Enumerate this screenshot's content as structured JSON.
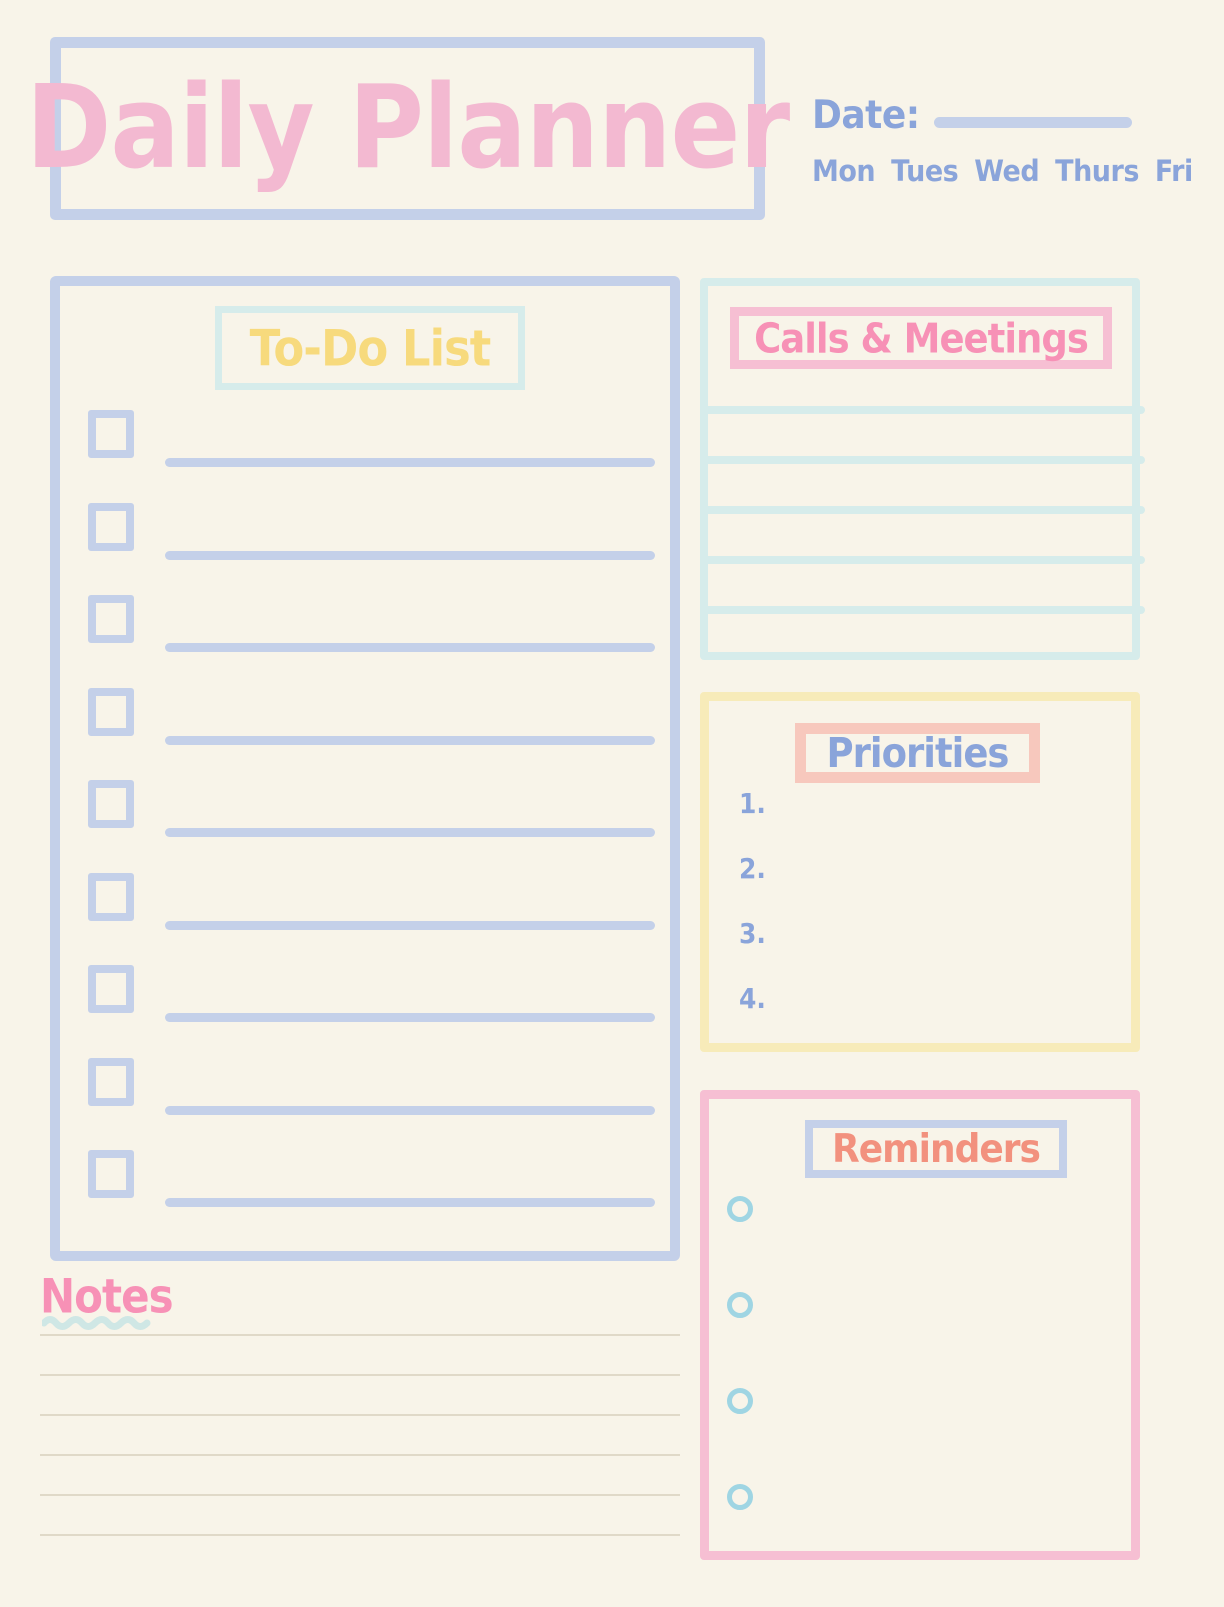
{
  "document": {
    "title": "Daily Planner",
    "background_color": "#f8f4e9"
  },
  "header": {
    "title": "Daily Planner",
    "title_color": "#f3b9d1",
    "title_box_border_color": "#c4d0e9",
    "date_label": "Date:",
    "date_value": "",
    "date_color": "#8aa4da",
    "weekdays": [
      "Mon",
      "Tues",
      "Wed",
      "Thurs",
      "Fri"
    ]
  },
  "todo": {
    "heading": "To-Do List",
    "heading_color": "#f7da7d",
    "heading_box_border_color": "#d6eceb",
    "panel_border_color": "#c4d0e9",
    "items": [
      {
        "checked": false,
        "text": ""
      },
      {
        "checked": false,
        "text": ""
      },
      {
        "checked": false,
        "text": ""
      },
      {
        "checked": false,
        "text": ""
      },
      {
        "checked": false,
        "text": ""
      },
      {
        "checked": false,
        "text": ""
      },
      {
        "checked": false,
        "text": ""
      },
      {
        "checked": false,
        "text": ""
      },
      {
        "checked": false,
        "text": ""
      }
    ]
  },
  "notes": {
    "heading": "Notes",
    "heading_color": "#f791b6",
    "underline_color": "#cfe7e5",
    "line_color": "#e0d9c8",
    "lines": [
      "",
      "",
      "",
      "",
      "",
      ""
    ]
  },
  "calls": {
    "heading": "Calls & Meetings",
    "heading_color": "#f791b6",
    "heading_box_border_color": "#f6bfd3",
    "panel_border_color": "#d6eceb",
    "rule_color": "#d6eceb",
    "lines": [
      "",
      "",
      "",
      "",
      ""
    ]
  },
  "priorities": {
    "heading": "Priorities",
    "heading_color": "#8aa4da",
    "heading_box_border_color": "#f7c8bd",
    "panel_border_color": "#f7ebb9",
    "items": [
      {
        "number": "1.",
        "text": ""
      },
      {
        "number": "2.",
        "text": ""
      },
      {
        "number": "3.",
        "text": ""
      },
      {
        "number": "4.",
        "text": ""
      }
    ]
  },
  "reminders": {
    "heading": "Reminders",
    "heading_color": "#f2917e",
    "heading_box_border_color": "#c4d0e9",
    "panel_border_color": "#f6bfd3",
    "bullet_color": "#9fd5e3",
    "items": [
      {
        "checked": false,
        "text": ""
      },
      {
        "checked": false,
        "text": ""
      },
      {
        "checked": false,
        "text": ""
      },
      {
        "checked": false,
        "text": ""
      }
    ]
  }
}
